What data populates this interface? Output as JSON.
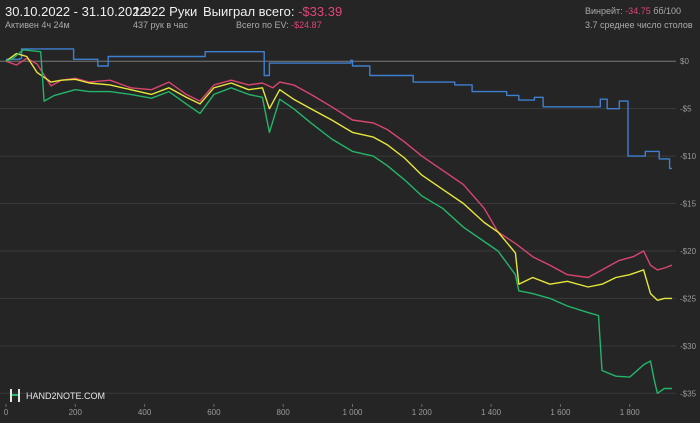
{
  "header": {
    "date_range": "30.10.2022 - 31.10.2022",
    "active": "Активен 4ч 24м",
    "hands": "1 922 Руки",
    "hands_rate": "437 рук в час",
    "won_label": "Выиграл всего:",
    "won_value": "-$33.39",
    "ev_label": "Всего по EV:",
    "ev_value": "-$24.87",
    "winrate_label": "Винрейт:",
    "winrate_value": "-34.75",
    "winrate_suffix": "бб/100",
    "tables": "3.7 среднее число столов"
  },
  "logo": {
    "text": "HAND2NOTE.COM"
  },
  "colors": {
    "background": "#252525",
    "grid": "#3a3a3a",
    "zero_line": "#7a7a7a",
    "blue": "#3f7fd0",
    "pink": "#d9456f",
    "yellow": "#e6e63c",
    "green": "#23b56a",
    "negative_text": "#e0457b"
  },
  "chart_data": {
    "type": "line",
    "xlim": [
      0,
      1922
    ],
    "ylim": [
      -35.5,
      1.5
    ],
    "x_ticks": [
      {
        "value": 0,
        "label": "0"
      },
      {
        "value": 200,
        "label": "200"
      },
      {
        "value": 400,
        "label": "400"
      },
      {
        "value": 600,
        "label": "600"
      },
      {
        "value": 800,
        "label": "800"
      },
      {
        "value": 1000,
        "label": "1 000"
      },
      {
        "value": 1200,
        "label": "1 200"
      },
      {
        "value": 1400,
        "label": "1 400"
      },
      {
        "value": 1600,
        "label": "1 600"
      },
      {
        "value": 1800,
        "label": "1 800"
      }
    ],
    "y_ticks": [
      {
        "value": 0,
        "label": "$0"
      },
      {
        "value": -5,
        "label": "-$5"
      },
      {
        "value": -10,
        "label": "-$10"
      },
      {
        "value": -15,
        "label": "-$15"
      },
      {
        "value": -20,
        "label": "-$20"
      },
      {
        "value": -25,
        "label": "-$25"
      },
      {
        "value": -30,
        "label": "-$30"
      },
      {
        "value": -35,
        "label": "-$35"
      }
    ],
    "series": [
      {
        "color": "blue",
        "step": true,
        "points": [
          [
            0,
            0.2
          ],
          [
            40,
            0.3
          ],
          [
            45,
            1.3
          ],
          [
            190,
            1.3
          ],
          [
            195,
            0.2
          ],
          [
            260,
            0.2
          ],
          [
            265,
            -0.5
          ],
          [
            290,
            -0.5
          ],
          [
            295,
            0.5
          ],
          [
            570,
            0.5
          ],
          [
            575,
            1.0
          ],
          [
            740,
            1.0
          ],
          [
            745,
            -1.5
          ],
          [
            755,
            -1.5
          ],
          [
            760,
            -0.2
          ],
          [
            990,
            -0.2
          ],
          [
            995,
            0.1
          ],
          [
            1000,
            -0.5
          ],
          [
            1045,
            -0.5
          ],
          [
            1050,
            -1.5
          ],
          [
            1170,
            -1.5
          ],
          [
            1175,
            -2.2
          ],
          [
            1290,
            -2.2
          ],
          [
            1295,
            -2.5
          ],
          [
            1340,
            -2.5
          ],
          [
            1345,
            -3.2
          ],
          [
            1440,
            -3.2
          ],
          [
            1445,
            -3.6
          ],
          [
            1475,
            -3.6
          ],
          [
            1480,
            -4.1
          ],
          [
            1520,
            -4.1
          ],
          [
            1525,
            -3.8
          ],
          [
            1545,
            -3.8
          ],
          [
            1550,
            -4.8
          ],
          [
            1710,
            -4.8
          ],
          [
            1715,
            -4.0
          ],
          [
            1730,
            -4.0
          ],
          [
            1735,
            -5.0
          ],
          [
            1765,
            -5.0
          ],
          [
            1770,
            -4.2
          ],
          [
            1790,
            -4.2
          ],
          [
            1795,
            -10.0
          ],
          [
            1840,
            -10.0
          ],
          [
            1845,
            -9.5
          ],
          [
            1880,
            -9.5
          ],
          [
            1885,
            -10.3
          ],
          [
            1910,
            -10.3
          ],
          [
            1915,
            -11.3
          ],
          [
            1922,
            -11.3
          ]
        ]
      },
      {
        "color": "pink",
        "step": false,
        "points": [
          [
            0,
            0
          ],
          [
            30,
            -0.4
          ],
          [
            60,
            0.3
          ],
          [
            90,
            -0.3
          ],
          [
            130,
            -2.6
          ],
          [
            160,
            -2.0
          ],
          [
            200,
            -1.8
          ],
          [
            240,
            -2.2
          ],
          [
            300,
            -2.0
          ],
          [
            360,
            -2.8
          ],
          [
            420,
            -3.0
          ],
          [
            470,
            -2.2
          ],
          [
            520,
            -3.5
          ],
          [
            560,
            -4.2
          ],
          [
            600,
            -2.5
          ],
          [
            650,
            -2.0
          ],
          [
            700,
            -2.5
          ],
          [
            740,
            -2.3
          ],
          [
            770,
            -2.8
          ],
          [
            790,
            -2.2
          ],
          [
            830,
            -2.5
          ],
          [
            880,
            -3.5
          ],
          [
            940,
            -4.8
          ],
          [
            1000,
            -6.2
          ],
          [
            1060,
            -6.5
          ],
          [
            1100,
            -7.2
          ],
          [
            1150,
            -8.5
          ],
          [
            1200,
            -10.0
          ],
          [
            1260,
            -11.5
          ],
          [
            1320,
            -13.0
          ],
          [
            1380,
            -15.5
          ],
          [
            1420,
            -18.0
          ],
          [
            1470,
            -19.2
          ],
          [
            1520,
            -20.6
          ],
          [
            1570,
            -21.5
          ],
          [
            1620,
            -22.5
          ],
          [
            1680,
            -22.8
          ],
          [
            1720,
            -22.0
          ],
          [
            1770,
            -21.0
          ],
          [
            1810,
            -20.6
          ],
          [
            1840,
            -20.0
          ],
          [
            1860,
            -21.5
          ],
          [
            1880,
            -22.0
          ],
          [
            1900,
            -21.8
          ],
          [
            1922,
            -21.5
          ]
        ]
      },
      {
        "color": "yellow",
        "step": false,
        "points": [
          [
            0,
            0
          ],
          [
            30,
            0.8
          ],
          [
            60,
            0.5
          ],
          [
            90,
            -1.2
          ],
          [
            130,
            -2.2
          ],
          [
            160,
            -2.0
          ],
          [
            200,
            -1.9
          ],
          [
            240,
            -2.3
          ],
          [
            300,
            -2.5
          ],
          [
            360,
            -3.0
          ],
          [
            420,
            -3.5
          ],
          [
            470,
            -2.8
          ],
          [
            520,
            -3.8
          ],
          [
            560,
            -4.5
          ],
          [
            600,
            -2.8
          ],
          [
            650,
            -2.3
          ],
          [
            700,
            -3.0
          ],
          [
            740,
            -2.8
          ],
          [
            760,
            -5.0
          ],
          [
            790,
            -3.0
          ],
          [
            830,
            -4.0
          ],
          [
            880,
            -5.0
          ],
          [
            940,
            -6.2
          ],
          [
            1000,
            -7.5
          ],
          [
            1060,
            -8.0
          ],
          [
            1100,
            -8.8
          ],
          [
            1150,
            -10.2
          ],
          [
            1200,
            -12.0
          ],
          [
            1260,
            -13.5
          ],
          [
            1320,
            -15.0
          ],
          [
            1380,
            -17.0
          ],
          [
            1420,
            -18.0
          ],
          [
            1470,
            -20.2
          ],
          [
            1480,
            -23.5
          ],
          [
            1520,
            -22.8
          ],
          [
            1570,
            -23.5
          ],
          [
            1620,
            -23.2
          ],
          [
            1680,
            -23.8
          ],
          [
            1720,
            -23.5
          ],
          [
            1760,
            -22.8
          ],
          [
            1800,
            -22.5
          ],
          [
            1840,
            -22.0
          ],
          [
            1860,
            -24.5
          ],
          [
            1880,
            -25.2
          ],
          [
            1900,
            -25.0
          ],
          [
            1922,
            -25.0
          ]
        ]
      },
      {
        "color": "green",
        "step": false,
        "points": [
          [
            0,
            0
          ],
          [
            20,
            0.3
          ],
          [
            50,
            1.2
          ],
          [
            100,
            1.0
          ],
          [
            110,
            -4.2
          ],
          [
            140,
            -3.6
          ],
          [
            200,
            -3.0
          ],
          [
            240,
            -3.2
          ],
          [
            300,
            -3.2
          ],
          [
            360,
            -3.5
          ],
          [
            420,
            -3.9
          ],
          [
            470,
            -3.2
          ],
          [
            520,
            -4.5
          ],
          [
            560,
            -5.5
          ],
          [
            600,
            -3.5
          ],
          [
            650,
            -2.8
          ],
          [
            700,
            -3.5
          ],
          [
            740,
            -3.8
          ],
          [
            760,
            -7.5
          ],
          [
            790,
            -4.0
          ],
          [
            830,
            -5.0
          ],
          [
            880,
            -6.5
          ],
          [
            940,
            -8.2
          ],
          [
            1000,
            -9.5
          ],
          [
            1060,
            -10.0
          ],
          [
            1100,
            -11.0
          ],
          [
            1150,
            -12.5
          ],
          [
            1200,
            -14.2
          ],
          [
            1260,
            -15.5
          ],
          [
            1320,
            -17.5
          ],
          [
            1380,
            -19.0
          ],
          [
            1420,
            -20.0
          ],
          [
            1470,
            -22.5
          ],
          [
            1480,
            -24.2
          ],
          [
            1520,
            -24.5
          ],
          [
            1570,
            -25.0
          ],
          [
            1620,
            -25.8
          ],
          [
            1680,
            -26.5
          ],
          [
            1710,
            -26.8
          ],
          [
            1720,
            -32.6
          ],
          [
            1760,
            -33.2
          ],
          [
            1800,
            -33.3
          ],
          [
            1840,
            -32.0
          ],
          [
            1860,
            -31.6
          ],
          [
            1870,
            -33.5
          ],
          [
            1880,
            -35.0
          ],
          [
            1900,
            -34.5
          ],
          [
            1922,
            -34.5
          ]
        ]
      }
    ]
  }
}
